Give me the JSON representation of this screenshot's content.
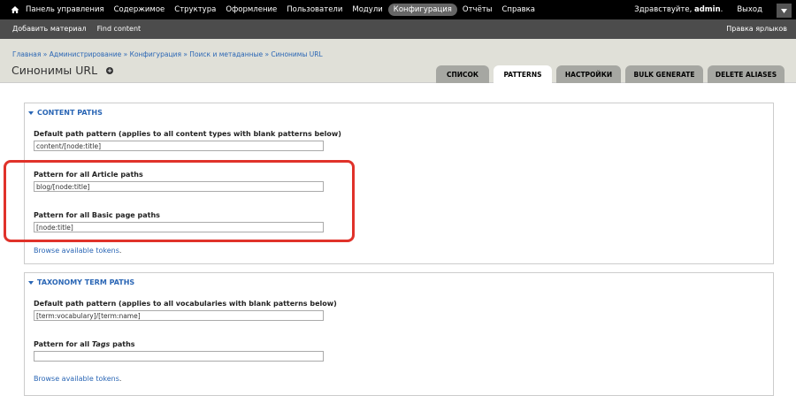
{
  "toolbar": {
    "menu": [
      "Панель управления",
      "Содержимое",
      "Структура",
      "Оформление",
      "Пользователи",
      "Модули",
      "Конфигурация",
      "Отчёты",
      "Справка"
    ],
    "greeting": "Здравствуйте, ",
    "username": "admin",
    "greeting_end": ".",
    "logout": "Выход"
  },
  "shortcuts": {
    "items": [
      "Добавить материал",
      "Find content"
    ],
    "edit": "Правка ярлыков"
  },
  "breadcrumb": "Главная » Администрирование » Конфигурация » Поиск и метаданные » Синонимы URL",
  "page_title": "Синонимы URL",
  "tabs": [
    "Список",
    "Patterns",
    "Настройки",
    "Bulk generate",
    "Delete aliases"
  ],
  "content_paths": {
    "legend": "Content paths",
    "fields": [
      {
        "label": "Default path pattern (applies to all content types with blank patterns below)",
        "value": "content/[node:title]"
      },
      {
        "label": "Pattern for all Article paths",
        "value": "blog/[node:title]"
      },
      {
        "label": "Pattern for all Basic page paths",
        "value": "[node:title]"
      }
    ],
    "tokens_link": "Browse available tokens",
    "tokens_dot": "."
  },
  "taxonomy_paths": {
    "legend": "Taxonomy term paths",
    "fields": [
      {
        "label": "Default path pattern (applies to all vocabularies with blank patterns below)",
        "value": "[term:vocabulary]/[term:name]"
      },
      {
        "label_pre": "Pattern for all ",
        "label_em": "Tags",
        "label_post": " paths",
        "value": ""
      }
    ],
    "tokens_link": "Browse available tokens",
    "tokens_dot": "."
  },
  "colors": {
    "link": "#2a66b5",
    "highlight": "#e0322a",
    "toolbar": "#000000",
    "header": "#e0e0d8"
  }
}
